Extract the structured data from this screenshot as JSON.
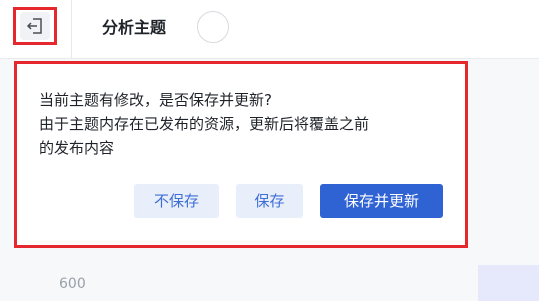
{
  "header": {
    "title": "分析主题",
    "exit_icon": "exit-icon"
  },
  "background": {
    "axis_label": "600"
  },
  "dialog": {
    "line1": "当前主题有修改，是否保存并更新?",
    "line2": "由于主题内存在已发布的资源，更新后将覆盖之前",
    "line3": "的发布内容",
    "buttons": {
      "dont_save": "不保存",
      "save": "保存",
      "save_and_update": "保存并更新"
    }
  },
  "colors": {
    "highlight_outline": "#e5282e",
    "primary": "#2f63d4",
    "light_button_bg": "#e9eefb"
  }
}
